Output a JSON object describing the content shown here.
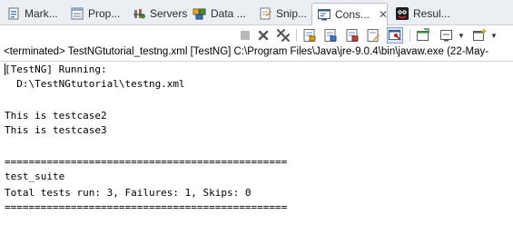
{
  "tabs": [
    {
      "label": "Mark...",
      "icon": "markers-icon",
      "active": false
    },
    {
      "label": "Prop...",
      "icon": "properties-icon",
      "active": false
    },
    {
      "label": "Servers",
      "icon": "servers-icon",
      "active": false
    },
    {
      "label": "Data ...",
      "icon": "data-source-explorer-icon",
      "active": false
    },
    {
      "label": "Snip...",
      "icon": "snippets-icon",
      "active": false
    },
    {
      "label": "Cons...",
      "icon": "console-icon",
      "active": true,
      "close": "✕"
    },
    {
      "label": "Resul...",
      "icon": "testng-results-icon",
      "active": false
    }
  ],
  "toolbar": {
    "icons": [
      "terminate-icon",
      "remove-launch-icon",
      "remove-all-terminated-icon",
      "scroll-lock-icon",
      "show-stdout-icon",
      "show-stderr-icon",
      "clear-console-icon",
      "pin-console-icon",
      "display-selected-console-icon",
      "open-console-icon"
    ]
  },
  "description": "<terminated> TestNGtutorial_testng.xml [TestNG] C:\\Program Files\\Java\\jre-9.0.4\\bin\\javaw.exe (22-May-",
  "console_lines": [
    "[TestNG] Running:",
    "  D:\\TestNGtutorial\\testng.xml",
    "",
    "This is testcase2",
    "This is testcase3",
    "",
    "===============================================",
    "test_suite",
    "Total tests run: 3, Failures: 1, Skips: 0",
    "==============================================="
  ],
  "colors": {
    "tabbar_bg": "#ebeff4",
    "active_tab_bg": "#ffffff",
    "text": "#000000"
  }
}
